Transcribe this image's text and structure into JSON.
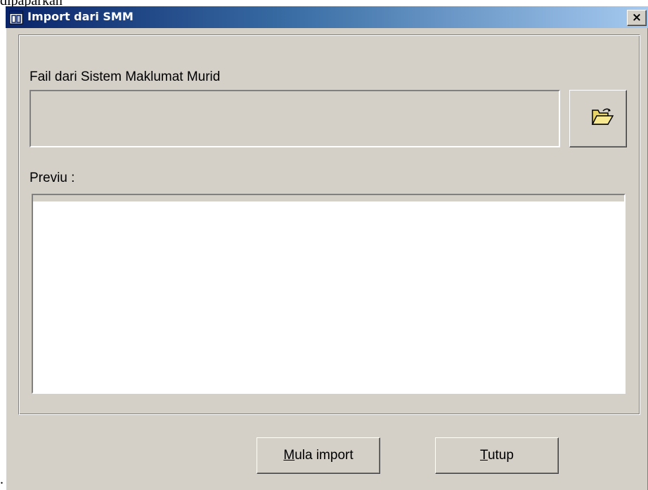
{
  "background": {
    "top_text": "dipaparkan",
    "bottom_text": "."
  },
  "window": {
    "title": "Import dari SMM",
    "close_label": "×"
  },
  "form": {
    "file_label": "Fail dari Sistem Maklumat Murid",
    "file_value": "",
    "preview_label": "Previu :"
  },
  "buttons": {
    "start_mnemonic": "M",
    "start_rest": "ula import",
    "close_mnemonic": "T",
    "close_rest": "utup"
  },
  "colors": {
    "titlebar_start": "#0a246a",
    "titlebar_end": "#a6caf0",
    "face": "#d4d0c8"
  },
  "icons": {
    "title": "app-window-icon",
    "browse": "open-folder-icon"
  }
}
